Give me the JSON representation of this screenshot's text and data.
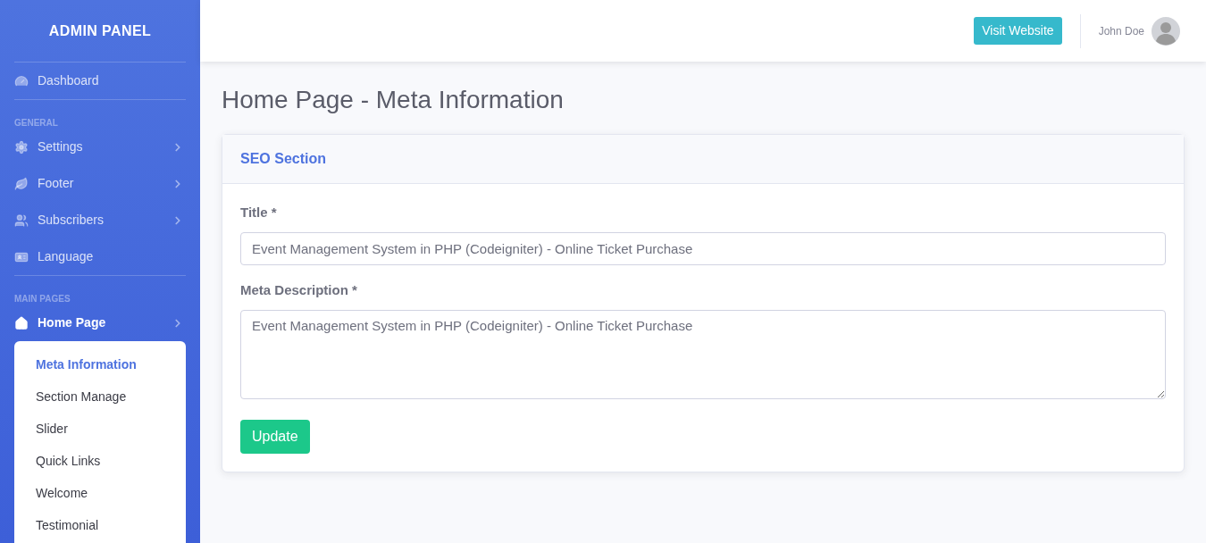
{
  "sidebar": {
    "brand": "ADMIN PANEL",
    "items": [
      {
        "kind": "divider"
      },
      {
        "kind": "link",
        "label": "Dashboard",
        "selected": false,
        "has_submenu": false
      },
      {
        "kind": "divider"
      },
      {
        "kind": "heading",
        "label": "GENERAL"
      },
      {
        "kind": "link",
        "label": "Settings",
        "selected": false,
        "has_submenu": true
      },
      {
        "kind": "link",
        "label": "Footer",
        "selected": false,
        "has_submenu": true
      },
      {
        "kind": "link",
        "label": "Subscribers",
        "selected": false,
        "has_submenu": true
      },
      {
        "kind": "link",
        "label": "Language",
        "selected": false,
        "has_submenu": false
      },
      {
        "kind": "divider"
      },
      {
        "kind": "heading",
        "label": "MAIN PAGES"
      },
      {
        "kind": "link",
        "label": "Home Page",
        "selected": true,
        "has_submenu": true,
        "children": [
          {
            "label": "Meta Information",
            "selected": true
          },
          {
            "label": "Section Manage",
            "selected": false
          },
          {
            "label": "Slider",
            "selected": false
          },
          {
            "label": "Quick Links",
            "selected": false
          },
          {
            "label": "Welcome",
            "selected": false
          },
          {
            "label": "Testimonial",
            "selected": false
          }
        ]
      }
    ]
  },
  "topbar": {
    "button": "Visit Website",
    "user": "John Doe"
  },
  "page_title": "Home Page - Meta Information",
  "card": {
    "header": "SEO Section",
    "fields": [
      {
        "kind": "input",
        "label": "Title *",
        "value": "Event Management System in PHP (Codeigniter) - Online Ticket Purchase"
      },
      {
        "kind": "textarea",
        "label": "Meta Description *",
        "value": "Event Management System in PHP (Codeigniter) - Online Ticket Purchase"
      }
    ],
    "submit": "Update"
  }
}
